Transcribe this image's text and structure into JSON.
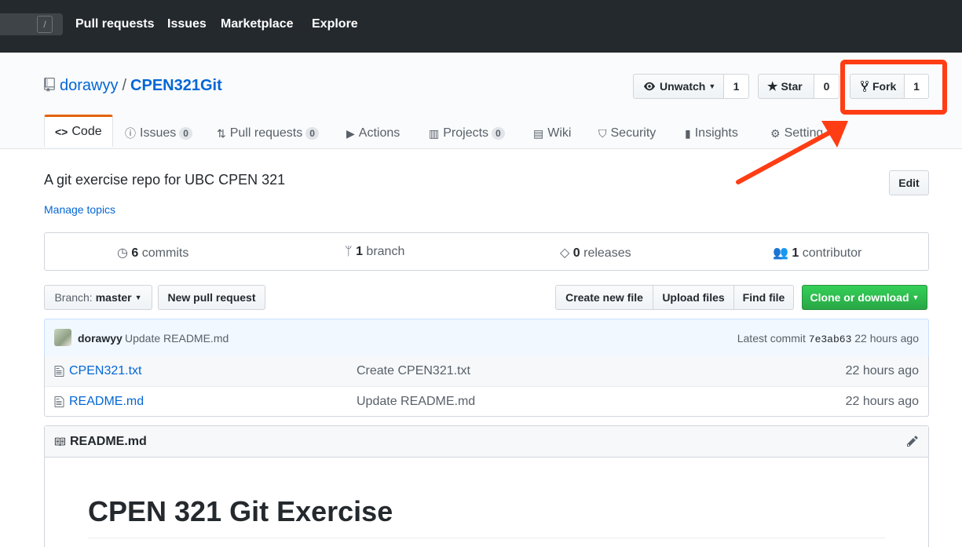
{
  "topnav": {
    "search_hint": "/",
    "links": [
      "Pull requests",
      "Issues",
      "Marketplace",
      "Explore"
    ]
  },
  "repo": {
    "owner": "dorawyy",
    "separator": "/",
    "name": "CPEN321Git",
    "watch_label": "Unwatch",
    "watch_count": "1",
    "star_label": "Star",
    "star_count": "0",
    "fork_label": "Fork",
    "fork_count": "1"
  },
  "tabs": [
    {
      "label": "Code",
      "icon": "code-icon"
    },
    {
      "label": "Issues",
      "count": "0",
      "icon": "issue-icon"
    },
    {
      "label": "Pull requests",
      "count": "0",
      "icon": "pull-request-icon"
    },
    {
      "label": "Actions",
      "icon": "play-icon"
    },
    {
      "label": "Projects",
      "count": "0",
      "icon": "project-icon"
    },
    {
      "label": "Wiki",
      "icon": "book-icon"
    },
    {
      "label": "Security",
      "icon": "shield-icon"
    },
    {
      "label": "Insights",
      "icon": "graph-icon"
    },
    {
      "label": "Settings",
      "icon": "gear-icon"
    }
  ],
  "about": {
    "description": "A git exercise repo for UBC CPEN 321",
    "manage_topics": "Manage topics",
    "edit_label": "Edit"
  },
  "summary": {
    "commits_count": "6",
    "commits_label": "commits",
    "branch_count": "1",
    "branch_label": "branch",
    "releases_count": "0",
    "releases_label": "releases",
    "contributor_count": "1",
    "contributor_label": "contributor"
  },
  "toolbar": {
    "branch_prefix": "Branch:",
    "branch_name": "master",
    "new_pr": "New pull request",
    "create_file": "Create new file",
    "upload_files": "Upload files",
    "find_file": "Find file",
    "clone": "Clone or download"
  },
  "latest_commit": {
    "author": "dorawyy",
    "message": "Update README.md",
    "prefix": "Latest commit",
    "sha": "7e3ab63",
    "age": "22 hours ago"
  },
  "files": [
    {
      "name": "CPEN321.txt",
      "message": "Create CPEN321.txt",
      "age": "22 hours ago"
    },
    {
      "name": "README.md",
      "message": "Update README.md",
      "age": "22 hours ago"
    }
  ],
  "readme": {
    "title": "README.md",
    "heading": "CPEN 321 Git Exercise"
  },
  "colors": {
    "highlight": "#ff3d14",
    "link": "#0366d6",
    "clone_green": "#28a745"
  }
}
